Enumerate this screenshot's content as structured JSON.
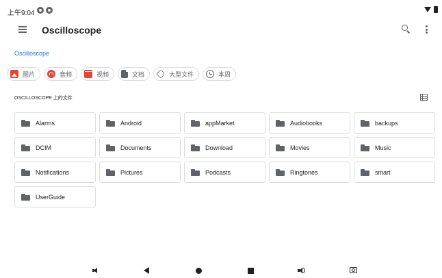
{
  "status_bar": {
    "time": "上午9:04"
  },
  "app_bar": {
    "title": "Oscilloscope"
  },
  "breadcrumb": "Oscilloscope",
  "chips": [
    {
      "label": "图片",
      "icon": "image-icon"
    },
    {
      "label": "音频",
      "icon": "audio-icon"
    },
    {
      "label": "视频",
      "icon": "video-icon"
    },
    {
      "label": "文档",
      "icon": "document-icon"
    },
    {
      "label": "大型文件",
      "icon": "tag-icon"
    },
    {
      "label": "本周",
      "icon": "history-icon"
    }
  ],
  "section": {
    "title": "OSCILLOSCOPE 上的文件"
  },
  "folders": [
    "Alarms",
    "Android",
    "appMarket",
    "Audiobooks",
    "backups",
    "DCIM",
    "Documents",
    "Download",
    "Movies",
    "Music",
    "Notifications",
    "Pictures",
    "Podcasts",
    "Ringtones",
    "smart",
    "UserGuide"
  ]
}
